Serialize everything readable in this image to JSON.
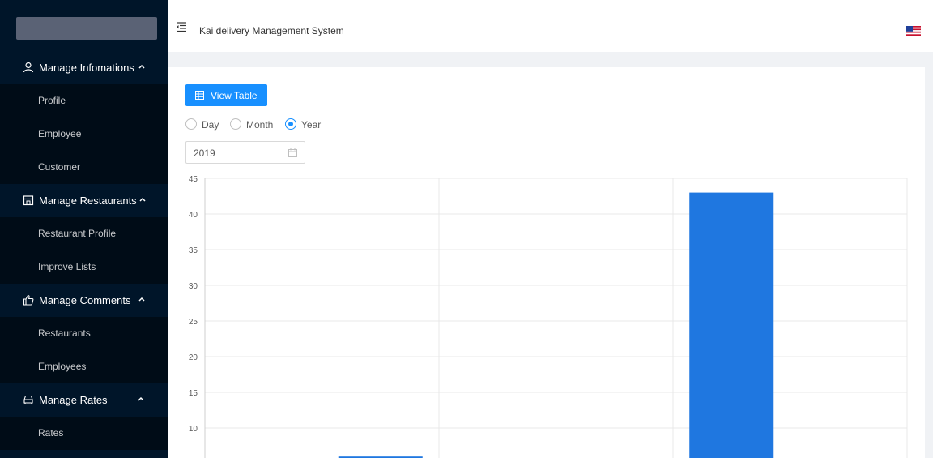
{
  "app": {
    "title": "Kai delivery Management System"
  },
  "sidebar": {
    "groups": [
      {
        "label": "Manage Infomations",
        "icon": "user-icon",
        "items": [
          "Profile",
          "Employee",
          "Customer"
        ]
      },
      {
        "label": "Manage Restaurants",
        "icon": "shop-icon",
        "items": [
          "Restaurant Profile",
          "Improve Lists"
        ]
      },
      {
        "label": "Manage Comments",
        "icon": "like-icon",
        "items": [
          "Restaurants",
          "Employees"
        ]
      },
      {
        "label": "Manage Rates",
        "icon": "car-icon",
        "items": [
          "Rates"
        ]
      }
    ]
  },
  "header": {
    "language_flag": "us-flag-icon"
  },
  "content": {
    "view_table_label": "View Table",
    "period_options": [
      "Day",
      "Month",
      "Year"
    ],
    "selected_period": "Year",
    "date_value": "2019"
  },
  "colors": {
    "sidebar": "#001529",
    "submenu": "#000c17",
    "accent": "#1890ff",
    "bar": "#1f77e0"
  },
  "chart_data": {
    "type": "bar",
    "ylim": [
      0,
      45
    ],
    "yticks": [
      10,
      15,
      20,
      25,
      30,
      35,
      40,
      45
    ],
    "categories": [
      "",
      "",
      "",
      "",
      "",
      ""
    ],
    "values": [
      null,
      6,
      null,
      null,
      43,
      null
    ],
    "grid": true
  }
}
